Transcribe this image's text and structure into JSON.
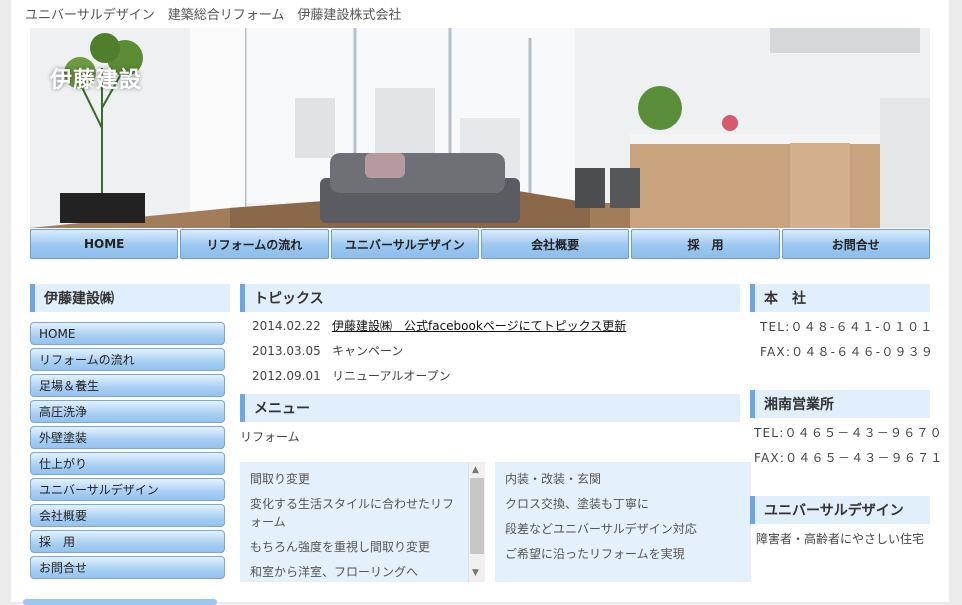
{
  "tagline": "ユニバーサルデザイン　建築総合リフォーム　伊藤建設株式会社",
  "hero": {
    "logo": "伊藤建設"
  },
  "nav": {
    "items": [
      "HOME",
      "リフォームの流れ",
      "ユニバーサルデザイン",
      "会社概要",
      "採　用",
      "お問合せ"
    ]
  },
  "left_sidebar": {
    "heading": "伊藤建設㈱",
    "items": [
      "HOME",
      "リフォームの流れ",
      "足場＆養生",
      "高圧洗浄",
      "外壁塗装",
      "仕上がり",
      "ユニバーサルデザイン",
      "会社概要",
      "採　用",
      "お問合せ"
    ]
  },
  "topics": {
    "heading": "トピックス",
    "items": [
      {
        "date": "2014.02.22",
        "text": "伊藤建設㈱　公式facebookページにてトピックス更新",
        "link": true
      },
      {
        "date": "2013.03.05",
        "text": "キャンペーン",
        "link": false
      },
      {
        "date": "2012.09.01",
        "text": "リニューアルオープン",
        "link": false
      }
    ]
  },
  "menu": {
    "heading": "メニュー",
    "intro": "リフォーム",
    "left_box": [
      "間取り変更",
      "変化する生活スタイルに合わせたリフォーム",
      "もちろん強度を重視し間取り変更",
      "和室から洋室、フローリングへ"
    ],
    "right_box": [
      "内装・改装・玄関",
      "クロス交換、塗装も丁寧に",
      "段差などユニバーサルデザイン対応",
      "ご希望に沿ったリフォームを実現"
    ]
  },
  "right_sidebar": {
    "head_office": {
      "heading": "本　社",
      "tel": "TEL:０４８-６４１-０１０１",
      "fax": "FAX:０４８-６４６-０９３９"
    },
    "shonan": {
      "heading": "湘南営業所",
      "tel": "TEL:０４６５－４３－９６７０",
      "fax": "FAX:０４６５－４３－９６７１"
    },
    "universal": {
      "heading": "ユニバーサルデザイン",
      "text": "障害者・高齢者にやさしい住宅"
    }
  },
  "colors": {
    "accent": "#6ea5e2",
    "heading_bg": "#e1eefc",
    "nav_button": "#9cc8f0"
  }
}
